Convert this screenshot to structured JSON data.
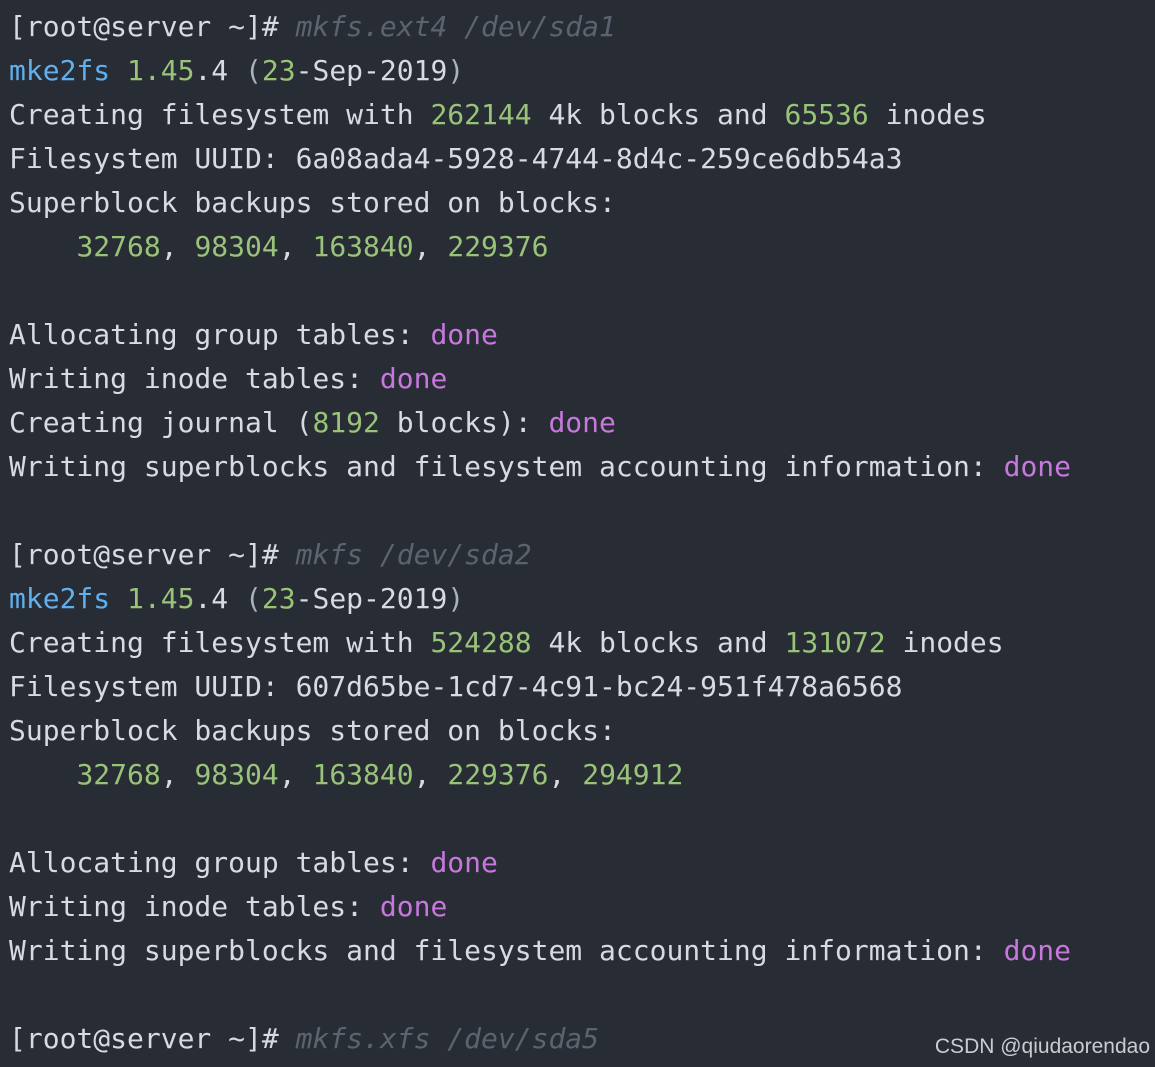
{
  "colors": {
    "background": "#282c34",
    "text": "#d7dae0",
    "number": "#98c379",
    "program": "#61afef",
    "done": "#c678dd",
    "command": "#5c6370"
  },
  "prompt": "[root@server ~]#",
  "commands": {
    "cmd1": "mkfs.ext4 /dev/sda1",
    "cmd2": "mkfs /dev/sda2",
    "cmd3": "mkfs.xfs /dev/sda5"
  },
  "version": {
    "program": "mke2fs",
    "ver_major": "1.45",
    "ver_minor": ".4",
    "open": "(",
    "date_day": "23",
    "date_rest": "-Sep-2019",
    "close": ")"
  },
  "text": {
    "creating_fs_prefix": "Creating filesystem with ",
    "blocks_and": " 4k blocks and ",
    "inodes": " inodes",
    "uuid_label": "Filesystem UUID: ",
    "superblock": "Superblock backups stored on blocks:",
    "indent": "    ",
    "comma": ", ",
    "alloc_group": "Allocating group tables: ",
    "writing_inode": "Writing inode tables: ",
    "creating_journal_prefix": "Creating journal (",
    "creating_journal_suffix": " blocks): ",
    "writing_superblocks": "Writing superblocks and filesystem accounting information: ",
    "done": "done"
  },
  "run1": {
    "blocks": "262144",
    "inodes": "65536",
    "uuid": "6a08ada4-5928-4744-8d4c-259ce6db54a3",
    "backups": [
      "32768",
      "98304",
      "163840",
      "229376"
    ],
    "journal_blocks": "8192"
  },
  "run2": {
    "blocks": "524288",
    "inodes": "131072",
    "uuid": "607d65be-1cd7-4c91-bc24-951f478a6568",
    "backups": [
      "32768",
      "98304",
      "163840",
      "229376",
      "294912"
    ]
  },
  "watermark": "CSDN @qiudaorendao"
}
